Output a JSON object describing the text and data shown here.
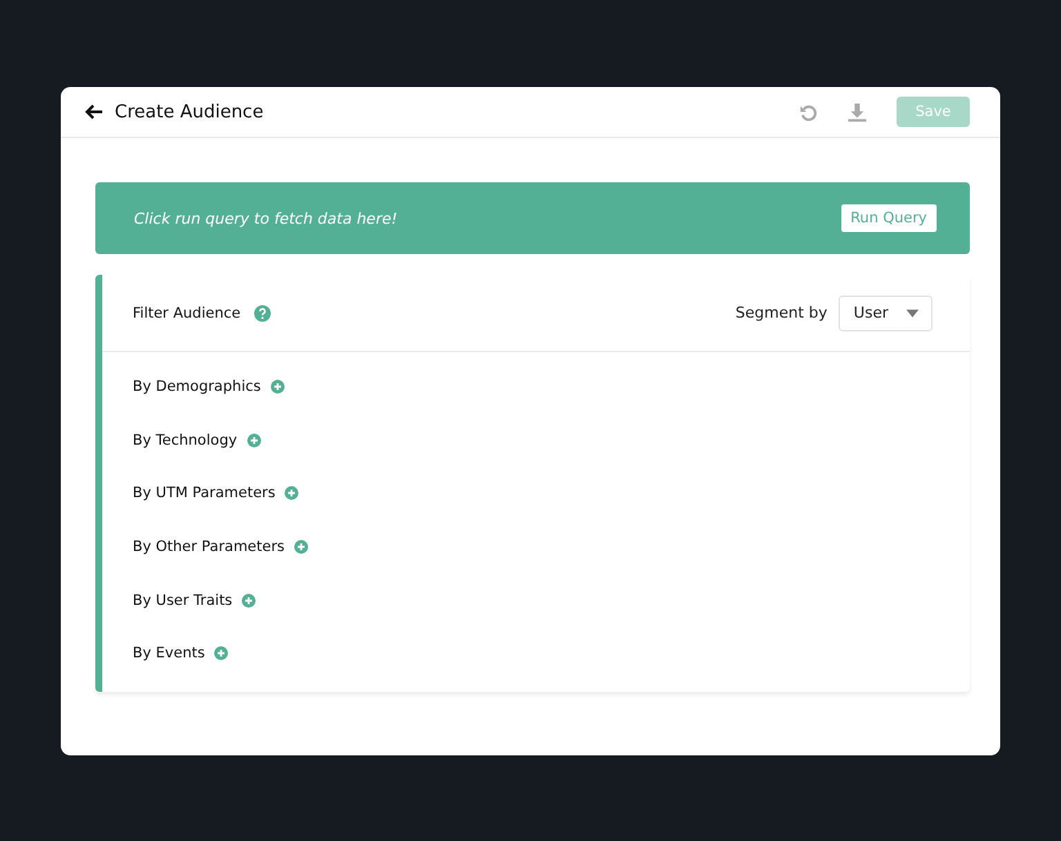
{
  "header": {
    "title": "Create Audience",
    "save": {
      "label": "Save",
      "disabled": true
    }
  },
  "banner": {
    "message": "Click run query to fetch data here!",
    "button": "Run Query"
  },
  "filter": {
    "title": "Filter Audience",
    "segment_label": "Segment by",
    "segment_value": "User",
    "groups": [
      {
        "label": "By Demographics"
      },
      {
        "label": "By Technology"
      },
      {
        "label": "By UTM Parameters"
      },
      {
        "label": "By Other Parameters"
      },
      {
        "label": "By User Traits"
      },
      {
        "label": "By Events"
      }
    ]
  }
}
